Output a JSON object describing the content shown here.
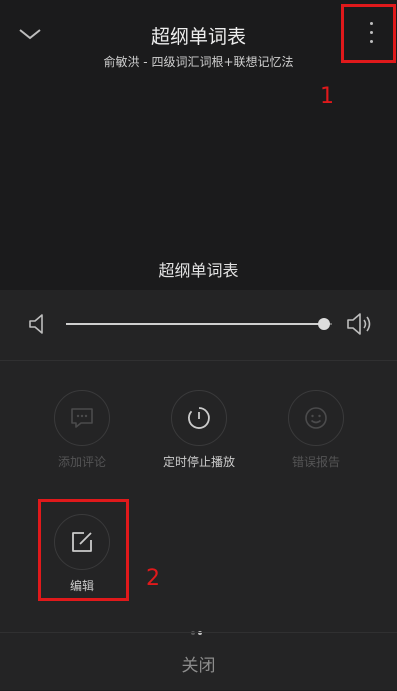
{
  "header": {
    "title": "超纲单词表",
    "subtitle": "俞敏洪 - 四级词汇词根+联想记忆法",
    "center_title": "超纲单词表"
  },
  "annotations": {
    "one": "1",
    "two": "2",
    "color": "#e0191b"
  },
  "volume": {
    "level": 0.97
  },
  "actions": {
    "comment": {
      "label": "添加评论",
      "enabled": false
    },
    "timer": {
      "label": "定时停止播放",
      "enabled": true
    },
    "report": {
      "label": "错误报告",
      "enabled": false
    },
    "edit": {
      "label": "编辑",
      "enabled": true
    }
  },
  "pager": {
    "count": 2,
    "active": 1
  },
  "footer": {
    "close_label": "关闭"
  }
}
